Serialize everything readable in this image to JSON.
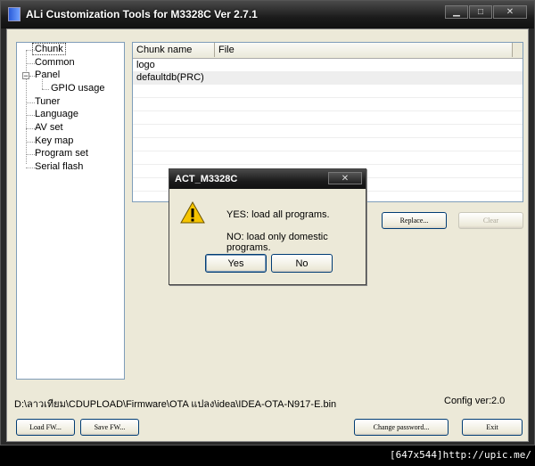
{
  "window": {
    "title": "ALi Customization Tools for M3328C  Ver 2.7.1",
    "minimize_glyph": "▁",
    "maximize_glyph": "□",
    "close_glyph": "✕"
  },
  "tree": {
    "items": [
      "Chunk",
      "Common",
      "Panel",
      "GPIO usage",
      "Tuner",
      "Language",
      "AV set",
      "Key map",
      "Program set",
      "Serial flash"
    ],
    "expander_glyph": "−"
  },
  "grid": {
    "columns": [
      "Chunk name",
      "File"
    ],
    "rows": [
      {
        "chunk": "logo",
        "file": ""
      },
      {
        "chunk": "defaultdb(PRC)",
        "file": ""
      }
    ]
  },
  "buttons": {
    "replace": "Replace...",
    "clear": "Clear",
    "load_fw": "Load FW...",
    "save_fw": "Save FW...",
    "change_password": "Change password...",
    "exit": "Exit"
  },
  "status": {
    "path": "D:\\ลาวเทียม\\CDUPLOAD\\Firmware\\OTA แปลง\\idea\\IDEA-OTA-N917-E.bin",
    "config_label": "Config ver:",
    "config_value": "2.0"
  },
  "dialog": {
    "title": "ACT_M3328C",
    "close_glyph": "✕",
    "message_yes": "YES: load all programs.",
    "message_no": "NO: load only domestic programs.",
    "yes_label": "Yes",
    "no_label": "No",
    "icon": "warning-icon"
  },
  "watermark": "[647x544]http://upic.me/"
}
